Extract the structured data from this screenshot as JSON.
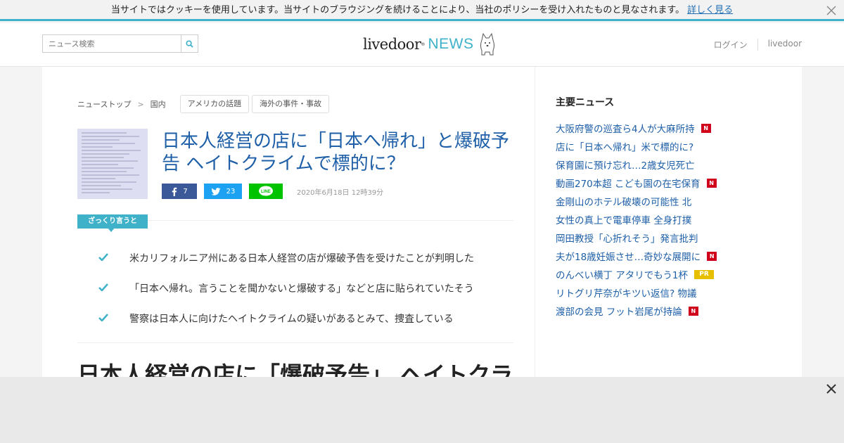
{
  "cookie": {
    "message": "当サイトではクッキーを使用しています。当サイトのブラウジングを続けることにより、当社のポリシーを受け入れたものと見なされます。",
    "link": "詳しく見る",
    "close_icon": "close-icon"
  },
  "header": {
    "search_placeholder": "ニュース検索",
    "logo_word": "livedoor",
    "logo_reg": "®",
    "logo_news": "NEWS",
    "login": "ログイン",
    "livedoor": "livedoor"
  },
  "breadcrumb": {
    "top": "ニューストップ",
    "category": "国内",
    "tags": [
      "アメリカの話題",
      "海外の事件・事故"
    ]
  },
  "article": {
    "title": "日本人経営の店に「日本へ帰れ」と爆破予告 ヘイトクライムで標的に？",
    "fb_count": "7",
    "tw_count": "23",
    "line_label": "LINE",
    "date": "2020年6月18日 12時39分",
    "summary_label": "ざっくり言うと",
    "points": [
      "米カリフォルニア州にある日本人経営の店が爆破予告を受けたことが判明した",
      "「日本へ帰れ。言うことを聞かないと爆破する」などと店に貼られていたそう",
      "警察は日本人に向けたヘイトクライムの疑いがあるとみて、捜査している"
    ],
    "heading": "日本人経営の店に「爆破予告」 ヘイトクライム"
  },
  "sidebar": {
    "title": "主要ニュース",
    "items": [
      {
        "text": "大阪府警の巡査ら4人が大麻所持",
        "badge": "N"
      },
      {
        "text": "店に「日本へ帰れ」米で標的に?",
        "badge": ""
      },
      {
        "text": "保育園に預け忘れ…2歳女児死亡",
        "badge": ""
      },
      {
        "text": "動画270本超 こども園の在宅保育",
        "badge": "N"
      },
      {
        "text": "金剛山のホテル破壊の可能性 北",
        "badge": ""
      },
      {
        "text": "女性の真上で電車停車 全身打撲",
        "badge": ""
      },
      {
        "text": "岡田教授「心折れそう」発言批判",
        "badge": ""
      },
      {
        "text": "夫が18歳妊娠させ…奇妙な展開に",
        "badge": "N"
      },
      {
        "text": "のんべい横丁 アタリでもう1杯",
        "badge": "PR"
      },
      {
        "text": "リトグリ芹奈がキツい返信? 物議",
        "badge": ""
      },
      {
        "text": "渡部の会見 フット岩尾が持論",
        "badge": "N"
      }
    ]
  },
  "colors": {
    "accent": "#3fb1c9",
    "link": "#1e5fa8",
    "facebook": "#3b5998",
    "twitter": "#1da1f2",
    "line": "#00c300",
    "badge_n": "#d0021b",
    "badge_pr": "#e6c000"
  }
}
